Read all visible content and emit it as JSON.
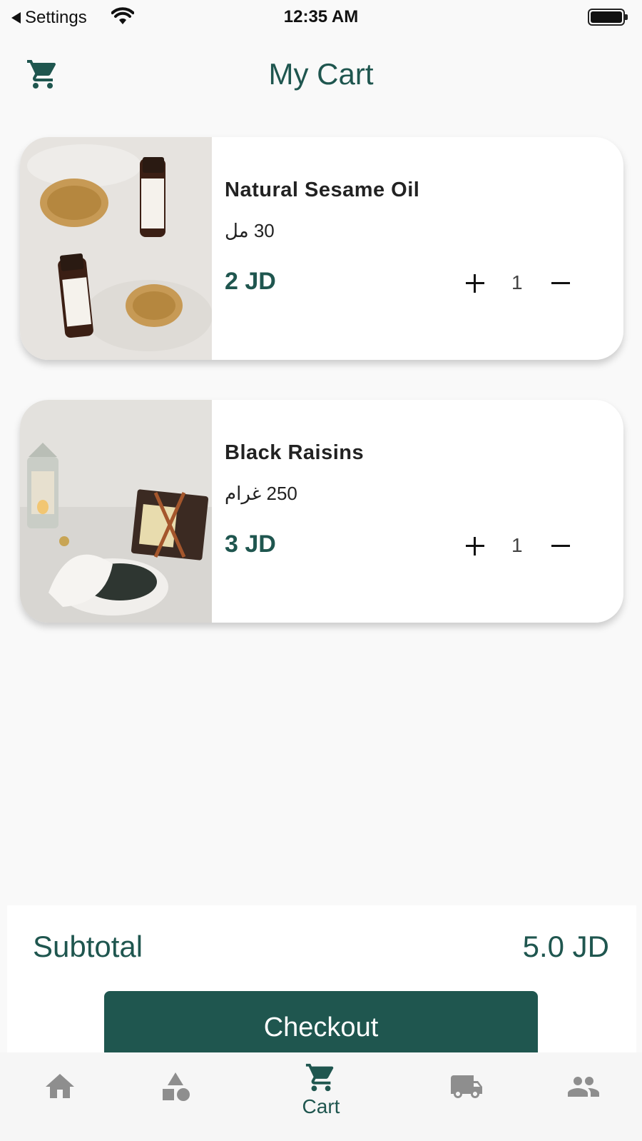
{
  "status_bar": {
    "back_label": "Settings",
    "time": "12:35 AM"
  },
  "header": {
    "title": "My Cart",
    "icon": "cart-icon"
  },
  "cart": {
    "items": [
      {
        "name": "Natural Sesame Oil",
        "size": "30 مل",
        "price": "2 JD",
        "quantity": "1",
        "image": "sesame-oil-photo"
      },
      {
        "name": "Black Raisins",
        "size": "250 غرام",
        "price": "3 JD",
        "quantity": "1",
        "image": "black-raisins-photo"
      }
    ]
  },
  "summary": {
    "subtotal_label": "Subtotal",
    "subtotal_value": "5.0 JD",
    "checkout_label": "Checkout"
  },
  "tab_bar": {
    "tabs": [
      {
        "icon": "home-icon",
        "label": ""
      },
      {
        "icon": "categories-icon",
        "label": ""
      },
      {
        "icon": "cart-icon",
        "label": "Cart",
        "active": true
      },
      {
        "icon": "delivery-truck-icon",
        "label": ""
      },
      {
        "icon": "people-icon",
        "label": ""
      }
    ]
  },
  "colors": {
    "brand": "#1f564f",
    "background": "#f9f9f9",
    "inactive_icon": "#8e8e8e"
  }
}
